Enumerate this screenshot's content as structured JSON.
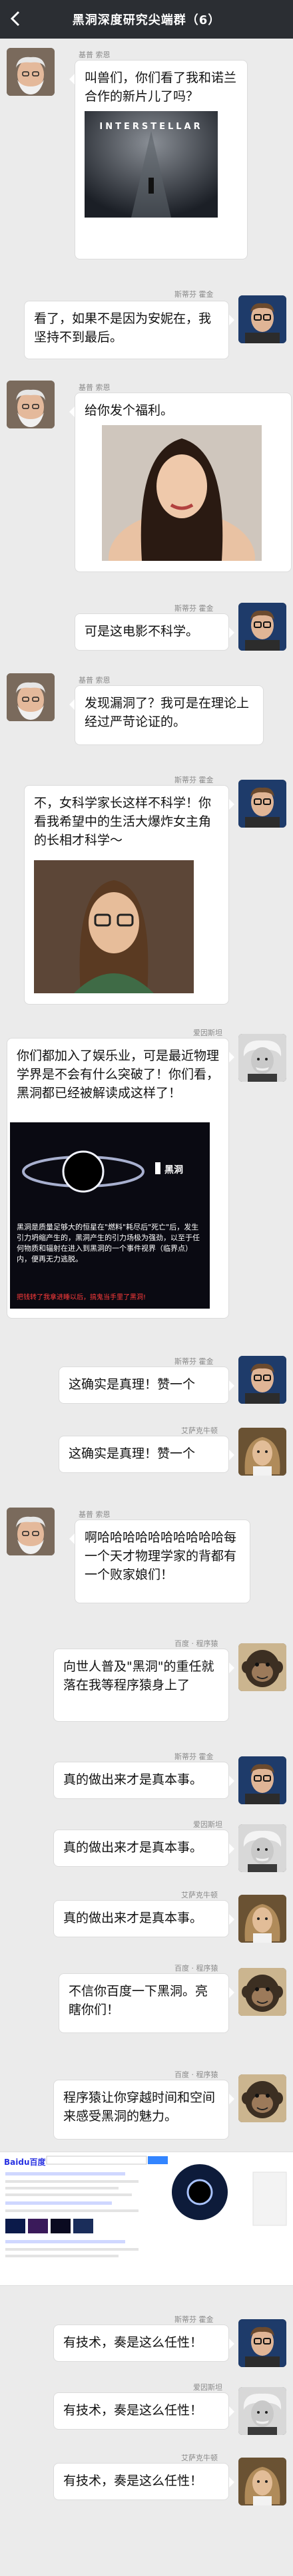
{
  "header": {
    "title": "黑洞深度研究尖端群（6）"
  },
  "users": {
    "kip": "基普 索恩",
    "hawking": "斯蒂芬 霍金",
    "einstein": "爱因斯坦",
    "newton": "艾萨克牛顿",
    "baidu": "百度 · 程序猿"
  },
  "messages": [
    {
      "text": "叫兽们，你们看了我和诺兰合作的新片儿了吗？"
    },
    {
      "poster_title": "INTERSTELLAR"
    },
    {
      "text": "看了，如果不是因为安妮在，我坚持不到最后。"
    },
    {
      "text": "给你发个福利。"
    },
    {
      "text": "可是这电影不科学。"
    },
    {
      "text": "发现漏洞了？我可是在理论上经过严苛论证的。"
    },
    {
      "text": "不，女科学家长这样不科学！你看我希望中的生活大爆炸女主角的长相才科学～"
    },
    {
      "text": "你们都加入了娱乐业，可是最近物理学界是不会有什么突破了！你们看，黑洞都已经被解读成这样了！"
    },
    {
      "image_label": "黑洞",
      "image_text": "黑洞是质量足够大的恒星在\"燃料\"耗尽后\"死亡\"后，发生引力坍缩产生的，黑洞产生的引力场极为强劲，以至于任何物质和辐射在进入到黑洞的一个事件视界（临界点）内，便再无力逃脱。",
      "image_footer": "把钱转了我拿进睡以后，搞鬼当手里了黑洞!"
    },
    {
      "text": "这确实是真理！赞一个"
    },
    {
      "text": "这确实是真理！赞一个"
    },
    {
      "text": "啊哈哈哈哈哈哈哈哈哈哈每一个天才物理学家的背都有一个败家娘们！"
    },
    {
      "text": "向世人普及\"黑洞\"的重任就落在我等程序猿身上了"
    },
    {
      "text": "真的做出来才是真本事。"
    },
    {
      "text": "真的做出来才是真本事。"
    },
    {
      "text": "真的做出来才是真本事。"
    },
    {
      "text": "不信你百度一下黑洞。亮瞎你们！"
    },
    {
      "text": "程序猿让你穿越时间和空间来感受黑洞的魅力。"
    },
    {
      "brand": "Baidu百度"
    },
    {
      "text": "有技术，奏是这么任性！"
    },
    {
      "text": "有技术，奏是这么任性！"
    },
    {
      "text": "有技术，奏是这么任性！"
    }
  ]
}
